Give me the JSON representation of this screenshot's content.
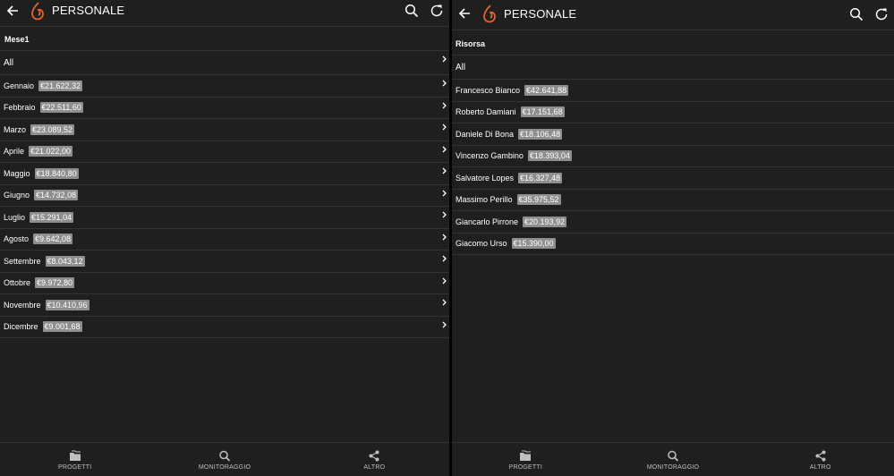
{
  "left": {
    "appbar": {
      "title": "PERSONALE",
      "back_icon": "back-arrow-icon",
      "search_icon": "search-icon",
      "refresh_icon": "refresh-icon"
    },
    "section_header": "Mese1",
    "all_label": "All",
    "rows": [
      {
        "label": "Gennaio",
        "amount": "€21.622,32"
      },
      {
        "label": "Febbraio",
        "amount": "€22.511,60"
      },
      {
        "label": "Marzo",
        "amount": "€23.089,52"
      },
      {
        "label": "Aprile",
        "amount": "€21.022,00"
      },
      {
        "label": "Maggio",
        "amount": "€18.840,80"
      },
      {
        "label": "Giugno",
        "amount": "€14.732,08"
      },
      {
        "label": "Luglio",
        "amount": "€15.291,04"
      },
      {
        "label": "Agosto",
        "amount": "€9.642,08"
      },
      {
        "label": "Settembre",
        "amount": "€8.043,12"
      },
      {
        "label": "Ottobre",
        "amount": "€9.972,80"
      },
      {
        "label": "Novembre",
        "amount": "€10.410,96"
      },
      {
        "label": "Dicembre",
        "amount": "€9.001,68"
      }
    ],
    "bottom_tabs": [
      {
        "label": "PROGETTI",
        "icon": "folder-icon"
      },
      {
        "label": "MONITORAGGIO",
        "icon": "search-icon"
      },
      {
        "label": "ALTRO",
        "icon": "share-icon"
      }
    ]
  },
  "right": {
    "appbar": {
      "title": "PERSONALE",
      "back_icon": "back-arrow-icon",
      "search_icon": "search-icon",
      "refresh_icon": "refresh-icon"
    },
    "section_header": "Risorsa",
    "all_label": "All",
    "rows": [
      {
        "label": "Francesco Bianco",
        "amount": "€42.641,88"
      },
      {
        "label": "Roberto Damiani",
        "amount": "€17.151,68"
      },
      {
        "label": "Daniele Di Bona",
        "amount": "€18.106,48"
      },
      {
        "label": "Vincenzo Gambino",
        "amount": "€18.393,04"
      },
      {
        "label": "Salvatore Lopes",
        "amount": "€16.327,48"
      },
      {
        "label": "Massimo Perillo",
        "amount": "€35.975,52"
      },
      {
        "label": "Giancarlo Pirrone",
        "amount": "€20.193,92"
      },
      {
        "label": "Giacomo Urso",
        "amount": "€15.390,00"
      }
    ],
    "bottom_tabs": [
      {
        "label": "PROGETTI",
        "icon": "folder-icon"
      },
      {
        "label": "MONITORAGGIO",
        "icon": "search-icon"
      },
      {
        "label": "ALTRO",
        "icon": "share-icon"
      }
    ]
  },
  "colors": {
    "background": "#1f1f1f",
    "badge": "#8e8e8e",
    "logo_accent": "#e8612c",
    "divider": "#333333"
  }
}
